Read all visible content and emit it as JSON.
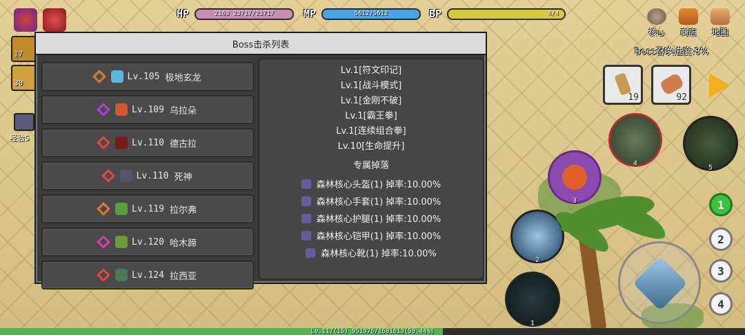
{
  "hud": {
    "hp_label": "HP",
    "hp_level": "2163",
    "hp_value": "23717/23717",
    "hp_fraction": 1.0,
    "mp_label": "MP",
    "mp_value": "5612/5612",
    "mp_fraction": 1.0,
    "bp_label": "BP",
    "bp_value": "4/4",
    "bp_fraction": 1.0,
    "colors": {
      "hp": "#c98fb0",
      "mp": "#4aa3e0",
      "bp": "#d4c93a"
    }
  },
  "menu": {
    "core_label": "核心",
    "shop_label": "商店",
    "map_label": "地图"
  },
  "summon_progress": "Boss召唤进度:8%",
  "modal": {
    "title": "Boss击杀列表",
    "bosses": [
      {
        "level": "Lv.105",
        "name": "极地玄龙",
        "rank_color": "#e07a30",
        "sprite_color": "#5bb8d6"
      },
      {
        "level": "Lv.109",
        "name": "乌拉朵",
        "rank_color": "#b040d0",
        "sprite_color": "#d05a30"
      },
      {
        "level": "Lv.110",
        "name": "德古拉",
        "rank_color": "#e04a3a",
        "sprite_color": "#7a1a1a"
      },
      {
        "level": "Lv.110",
        "name": "死神",
        "rank_color": "#e04a3a",
        "sprite_color": "#555566"
      },
      {
        "level": "Lv.119",
        "name": "拉尔弗",
        "rank_color": "#e07a30",
        "sprite_color": "#5aa040"
      },
      {
        "level": "Lv.120",
        "name": "哈木蹄",
        "rank_color": "#d040b0",
        "sprite_color": "#6a9a3a"
      },
      {
        "level": "Lv.124",
        "name": "拉西亚",
        "rank_color": "#e04a3a",
        "sprite_color": "#4a7a5a"
      }
    ],
    "detail": {
      "skills": [
        "Lv.1[符文印记]",
        "Lv.1[战斗模式]",
        "Lv.1[金刚不破]",
        "Lv.1[霸王拳]",
        "Lv.1[连续组合拳]",
        "Lv.10[生命提升]"
      ],
      "drops_title": "专属掉落",
      "drops": [
        "森林核心头盔(1) 掉率:10.00%",
        "森林核心手套(1) 掉率:10.00%",
        "森林核心护腿(1) 掉率:10.00%",
        "森林核心铠甲(1) 掉率:10.00%",
        "森林核心靴(1) 掉率:10.00%"
      ]
    }
  },
  "left": {
    "item1_count": "17",
    "item2_count": "30",
    "exp_label": "经验5"
  },
  "inventory": {
    "item1_count": "19",
    "item2_count": "92"
  },
  "skills": {
    "s1": "1",
    "s2": "2",
    "s3": "3",
    "s4": "4",
    "s5": "5"
  },
  "slots": [
    "1",
    "2",
    "3",
    "4"
  ],
  "xp": {
    "text": "Lv.117(15) 951976/1601613(59.44%)",
    "fraction": 0.5944
  }
}
